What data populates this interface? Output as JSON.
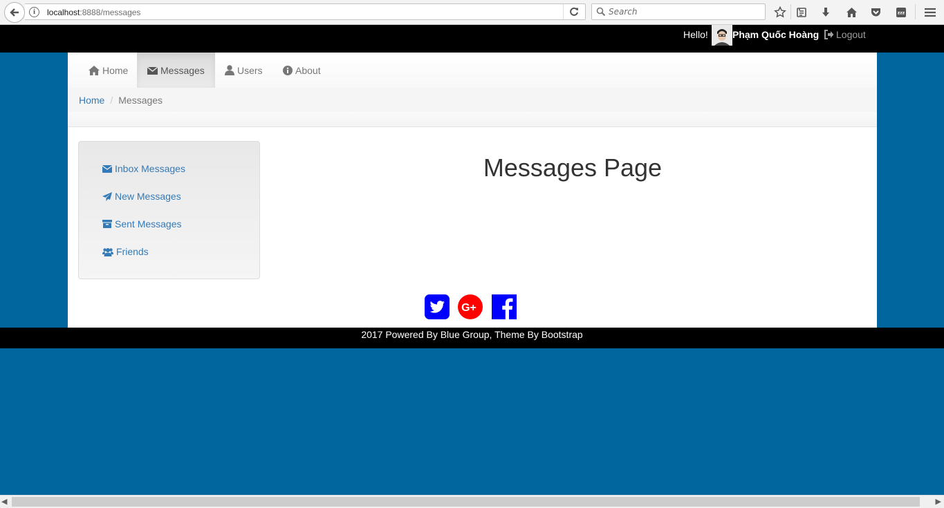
{
  "browser": {
    "url_host": "localhost",
    "url_rest": ":8888/messages",
    "search_placeholder": "Search"
  },
  "topbar": {
    "hello": "Hello!",
    "username": "Phạm Quốc Hoàng",
    "logout_label": "Logout"
  },
  "nav": {
    "items": [
      {
        "label": "Home",
        "icon": "home-icon"
      },
      {
        "label": "Messages",
        "icon": "envelope-icon",
        "active": true
      },
      {
        "label": "Users",
        "icon": "user-icon"
      },
      {
        "label": "About",
        "icon": "info-circle-icon"
      }
    ]
  },
  "breadcrumb": {
    "home": "Home",
    "separator": "/",
    "current": "Messages"
  },
  "sidebar": {
    "items": [
      {
        "label": "Inbox Messages",
        "icon": "envelope-icon"
      },
      {
        "label": "New Messages",
        "icon": "paper-plane-icon"
      },
      {
        "label": "Sent Messages",
        "icon": "archive-icon"
      },
      {
        "label": "Friends",
        "icon": "users-icon"
      }
    ]
  },
  "main": {
    "title": "Messages Page"
  },
  "social": [
    "twitter-icon",
    "google-plus-icon",
    "facebook-icon"
  ],
  "footer": {
    "text": "2017 Powered By Blue Group, Theme By Bootstrap"
  },
  "colors": {
    "page_bg": "#01669e",
    "link": "#337ab7",
    "navbar_bg": "#000000",
    "twitter": "#0000ff",
    "google": "#ff0000",
    "facebook": "#0000ff"
  }
}
